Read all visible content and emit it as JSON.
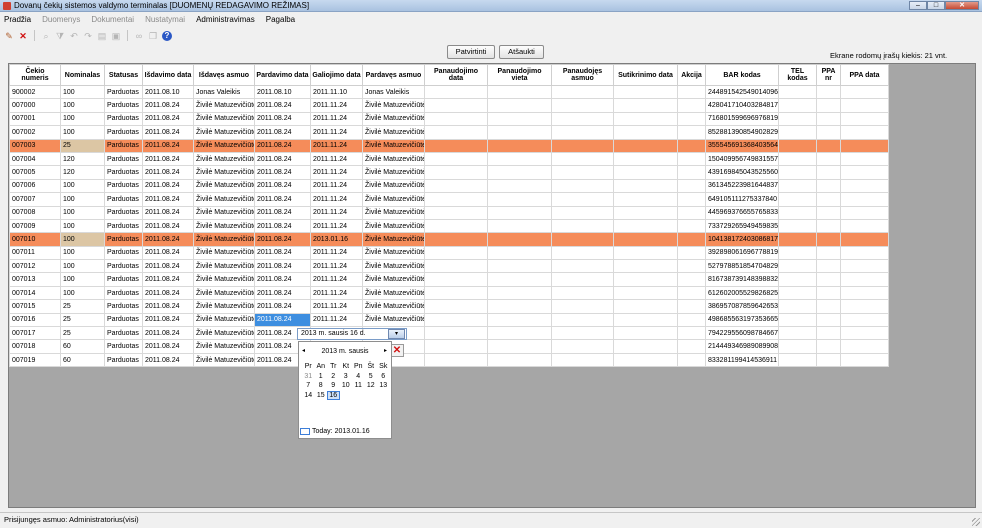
{
  "window": {
    "title": "Dovanų čekių sistemos valdymo terminalas [DUOMENŲ REDAGAVIMO REŽIMAS]",
    "minimize": "–",
    "maximize": "□",
    "close": "✕"
  },
  "menu": [
    {
      "label": "Pradžia",
      "enabled": true
    },
    {
      "label": "Duomenys",
      "enabled": false
    },
    {
      "label": "Dokumentai",
      "enabled": false
    },
    {
      "label": "Nustatymai",
      "enabled": false
    },
    {
      "label": "Administravimas",
      "enabled": true
    },
    {
      "label": "Pagalba",
      "enabled": true
    }
  ],
  "toolbar": {
    "icons": [
      "edit-icon",
      "delete-icon",
      "search-icon",
      "filter-icon",
      "undo-icon",
      "redo-icon",
      "print-icon",
      "save-icon",
      "binoculars-icon",
      "copy-icon",
      "help-icon"
    ]
  },
  "actions": {
    "confirm_label": "Patvirtinti",
    "cancel_label": "Atšaukti"
  },
  "grid_info": "Ekrane rodomų įrašų kiekis: 21 vnt.",
  "table": {
    "columns": [
      "Čekio numeris",
      "Nominalas",
      "Statusas",
      "Išdavimo data",
      "Išdavęs asmuo",
      "Pardavimo data",
      "Galiojimo data",
      "Pardavęs asmuo",
      "Panaudojimo data",
      "Panaudojimo vieta",
      "Panaudojęs asmuo",
      "Sutikrinimo data",
      "Akcija",
      "BAR kodas",
      "TEL kodas",
      "PPA nr",
      "PPA data"
    ],
    "rows": [
      {
        "no": "900002",
        "nominal": "100",
        "status": "Parduotas",
        "issued": "2011.08.10",
        "issuer": "Jonas Valeikis",
        "sold": "2011.08.10",
        "valid": "2011.11.10",
        "seller": "Jonas Valeikis",
        "bar": "244891542549014096",
        "highlight": false
      },
      {
        "no": "007000",
        "nominal": "100",
        "status": "Parduotas",
        "issued": "2011.08.24",
        "issuer": "Živilė Matuzevičiūtė",
        "sold": "2011.08.24",
        "valid": "2011.11.24",
        "seller": "Živilė Matuzevičiūtė",
        "bar": "428041710403284817",
        "highlight": false
      },
      {
        "no": "007001",
        "nominal": "100",
        "status": "Parduotas",
        "issued": "2011.08.24",
        "issuer": "Živilė Matuzevičiūtė",
        "sold": "2011.08.24",
        "valid": "2011.11.24",
        "seller": "Živilė Matuzevičiūtė",
        "bar": "716801599696976819",
        "highlight": false
      },
      {
        "no": "007002",
        "nominal": "100",
        "status": "Parduotas",
        "issued": "2011.08.24",
        "issuer": "Živilė Matuzevičiūtė",
        "sold": "2011.08.24",
        "valid": "2011.11.24",
        "seller": "Živilė Matuzevičiūtė",
        "bar": "852881390854902829",
        "highlight": false
      },
      {
        "no": "007003",
        "nominal": "25",
        "status": "Parduotas",
        "issued": "2011.08.24",
        "issuer": "Živilė Matuzevičiūtė",
        "sold": "2011.08.24",
        "valid": "2011.11.24",
        "seller": "Živilė Matuzevičiūtė",
        "bar": "355545691368403564",
        "highlight": true
      },
      {
        "no": "007004",
        "nominal": "120",
        "status": "Parduotas",
        "issued": "2011.08.24",
        "issuer": "Živilė Matuzevičiūtė",
        "sold": "2011.08.24",
        "valid": "2011.11.24",
        "seller": "Živilė Matuzevičiūtė",
        "bar": "150409956749831557",
        "highlight": false
      },
      {
        "no": "007005",
        "nominal": "120",
        "status": "Parduotas",
        "issued": "2011.08.24",
        "issuer": "Živilė Matuzevičiūtė",
        "sold": "2011.08.24",
        "valid": "2011.11.24",
        "seller": "Živilė Matuzevičiūtė",
        "bar": "439169845043525560",
        "highlight": false
      },
      {
        "no": "007006",
        "nominal": "100",
        "status": "Parduotas",
        "issued": "2011.08.24",
        "issuer": "Živilė Matuzevičiūtė",
        "sold": "2011.08.24",
        "valid": "2011.11.24",
        "seller": "Živilė Matuzevičiūtė",
        "bar": "361345223981644837",
        "highlight": false
      },
      {
        "no": "007007",
        "nominal": "100",
        "status": "Parduotas",
        "issued": "2011.08.24",
        "issuer": "Živilė Matuzevičiūtė",
        "sold": "2011.08.24",
        "valid": "2011.11.24",
        "seller": "Živilė Matuzevičiūtė",
        "bar": "649105111275337840",
        "highlight": false
      },
      {
        "no": "007008",
        "nominal": "100",
        "status": "Parduotas",
        "issued": "2011.08.24",
        "issuer": "Živilė Matuzevičiūtė",
        "sold": "2011.08.24",
        "valid": "2011.11.24",
        "seller": "Živilė Matuzevičiūtė",
        "bar": "445969376655765833",
        "highlight": false
      },
      {
        "no": "007009",
        "nominal": "100",
        "status": "Parduotas",
        "issued": "2011.08.24",
        "issuer": "Živilė Matuzevičiūtė",
        "sold": "2011.08.24",
        "valid": "2011.11.24",
        "seller": "Živilė Matuzevičiūtė",
        "bar": "733729265949459835",
        "highlight": false
      },
      {
        "no": "007010",
        "nominal": "100",
        "status": "Parduotas",
        "issued": "2011.08.24",
        "issuer": "Živilė Matuzevičiūtė",
        "sold": "2011.08.24",
        "valid": "2013.01.16",
        "seller": "Živilė Matuzevičiūtė",
        "bar": "104138172403086817",
        "highlight": true
      },
      {
        "no": "007011",
        "nominal": "100",
        "status": "Parduotas",
        "issued": "2011.08.24",
        "issuer": "Živilė Matuzevičiūtė",
        "sold": "2011.08.24",
        "valid": "2011.11.24",
        "seller": "Živilė Matuzevičiūtė",
        "bar": "392898061696778819",
        "highlight": false
      },
      {
        "no": "007012",
        "nominal": "100",
        "status": "Parduotas",
        "issued": "2011.08.24",
        "issuer": "Živilė Matuzevičiūtė",
        "sold": "2011.08.24",
        "valid": "2011.11.24",
        "seller": "Živilė Matuzevičiūtė",
        "bar": "527978851854704829",
        "highlight": false
      },
      {
        "no": "007013",
        "nominal": "100",
        "status": "Parduotas",
        "issued": "2011.08.24",
        "issuer": "Živilė Matuzevičiūtė",
        "sold": "2011.08.24",
        "valid": "2011.11.24",
        "seller": "Živilė Matuzevičiūtė",
        "bar": "816738739148398832",
        "highlight": false
      },
      {
        "no": "007014",
        "nominal": "100",
        "status": "Parduotas",
        "issued": "2011.08.24",
        "issuer": "Živilė Matuzevičiūtė",
        "sold": "2011.08.24",
        "valid": "2011.11.24",
        "seller": "Živilė Matuzevičiūtė",
        "bar": "612602005529826825",
        "highlight": false
      },
      {
        "no": "007015",
        "nominal": "25",
        "status": "Parduotas",
        "issued": "2011.08.24",
        "issuer": "Živilė Matuzevičiūtė",
        "sold": "2011.08.24",
        "valid": "2011.11.24",
        "seller": "Živilė Matuzevičiūtė",
        "bar": "386957087859642653",
        "highlight": false
      },
      {
        "no": "007016",
        "nominal": "25",
        "status": "Parduotas",
        "issued": "2011.08.24",
        "issuer": "Živilė Matuzevičiūtė",
        "sold": "2011.08.24",
        "valid": "2011.11.24",
        "seller": "Živilė Matuzevičiūtė",
        "bar": "498685563197353665",
        "highlight": false,
        "sold_selected": true
      },
      {
        "no": "007017",
        "nominal": "25",
        "status": "Parduotas",
        "issued": "2011.08.24",
        "issuer": "Živilė Matuzevičiūtė",
        "sold": "2011.08.24",
        "valid": "",
        "seller": "ūtė",
        "bar": "794229556098784667",
        "highlight": false
      },
      {
        "no": "007018",
        "nominal": "60",
        "status": "Parduotas",
        "issued": "2011.08.24",
        "issuer": "Živilė Matuzevičiūtė",
        "sold": "2011.08.24",
        "valid": "",
        "seller": "",
        "bar": "214449346989089908",
        "highlight": false
      },
      {
        "no": "007019",
        "nominal": "60",
        "status": "Parduotas",
        "issued": "2011.08.24",
        "issuer": "Živilė Matuzevičiūtė",
        "sold": "2011.08.24",
        "valid": "",
        "seller": "ūtė",
        "bar": "833281199414536911",
        "highlight": false
      }
    ]
  },
  "date_editor": {
    "value": "2013 m.  sausis  16 d.",
    "dropdown": "▾",
    "cancel": "✕"
  },
  "calendar": {
    "month_label": "2013 m. sausis",
    "prev": "◂",
    "next": "▸",
    "weekdays": [
      "Pr",
      "An",
      "Tr",
      "Kt",
      "Pn",
      "Št",
      "Sk"
    ],
    "days": [
      "31",
      "1",
      "2",
      "3",
      "4",
      "5",
      "6",
      "7",
      "8",
      "9",
      "10",
      "11",
      "12",
      "13",
      "14",
      "15",
      "16"
    ],
    "other_month_days": [
      "31"
    ],
    "selected_day": "16",
    "today_label": "Today: 2013.01.16"
  },
  "status": "Prisijungęs asmuo: Administratorius(visi)"
}
